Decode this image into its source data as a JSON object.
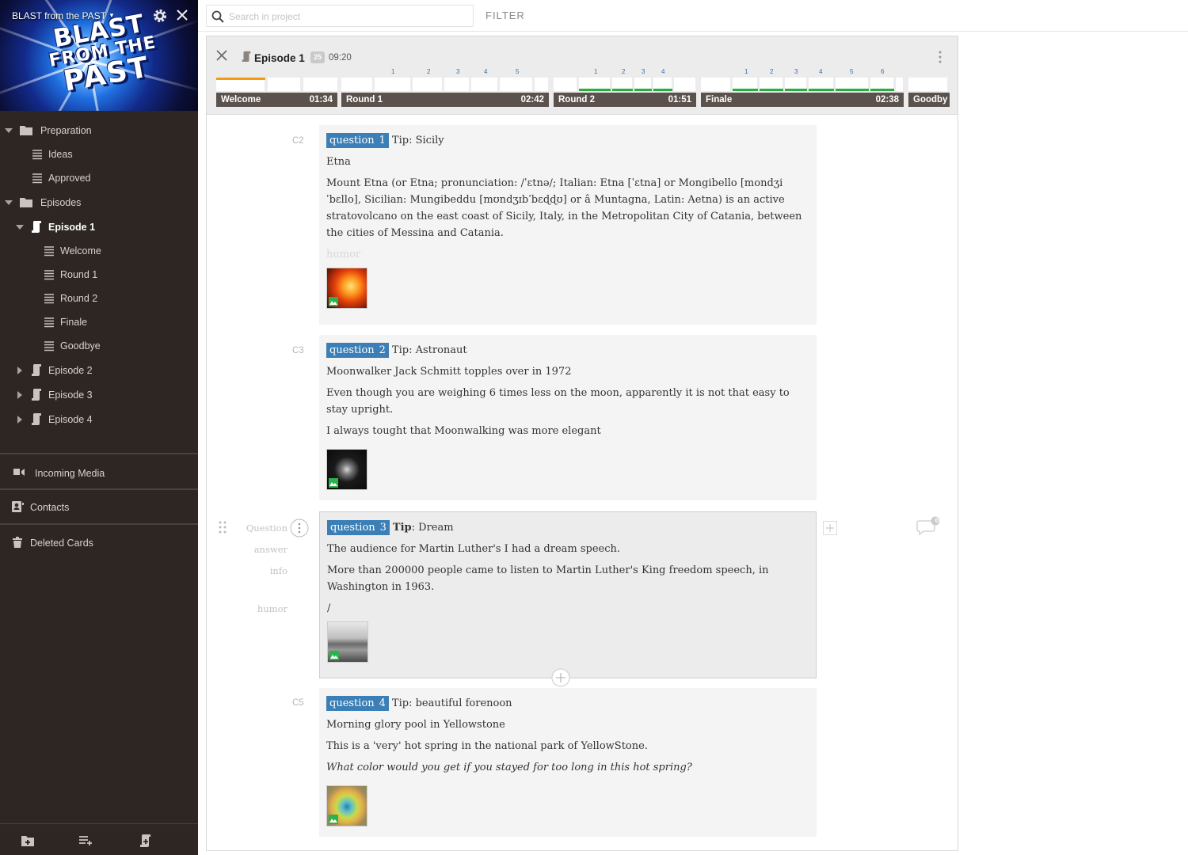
{
  "project": {
    "name": "BLAST from the PAST",
    "logo": {
      "line1": "BLAST",
      "line2": "FROM THE",
      "line3": "PAST"
    }
  },
  "tree": {
    "preparation": "Preparation",
    "ideas": "Ideas",
    "approved": "Approved",
    "episodes": "Episodes",
    "episode1": "Episode 1",
    "welcome": "Welcome",
    "round1": "Round 1",
    "round2": "Round 2",
    "finale": "Finale",
    "goodbye": "Goodbye",
    "episode2": "Episode 2",
    "episode3": "Episode 3",
    "episode4": "Episode 4"
  },
  "sidebar_items": {
    "incoming_media": "Incoming Media",
    "contacts": "Contacts",
    "deleted_cards": "Deleted Cards"
  },
  "search": {
    "placeholder": "Search in project",
    "value": ""
  },
  "filter_label": "FILTER",
  "episode": {
    "title": "Episode 1",
    "badge": "25",
    "duration": "09:20",
    "segments": [
      {
        "name": "Welcome",
        "duration": "01:34",
        "ticks": []
      },
      {
        "name": "Round 1",
        "duration": "02:42",
        "ticks": [
          "1",
          "2",
          "3",
          "4",
          "5"
        ]
      },
      {
        "name": "Round 2",
        "duration": "01:51",
        "ticks": [
          "1",
          "2",
          "3",
          "4"
        ]
      },
      {
        "name": "Finale",
        "duration": "02:38",
        "ticks": [
          "1",
          "2",
          "3",
          "4",
          "5",
          "6"
        ]
      },
      {
        "name": "Goodby",
        "duration": "",
        "ticks": []
      }
    ],
    "progress": {
      "welcome_fraction": 0.5
    }
  },
  "cards": [
    {
      "id": "C2",
      "badge": "question",
      "number": "1",
      "tip_label": "Tip",
      "tip": "Sicily",
      "answer": "Etna",
      "info": "Mount Etna (or Etna; pronunciation: /ˈɛtnə/; Italian: Etna [ˈɛtna] or Mongibello [mondʒiˈbɛllo], Sicilian: Mungibeddu [mʊndʒɪbˈbɛɖɖʊ] or â Muntagna, Latin: Aetna) is an active stratovolcano on the east coast of Sicily, Italy, in the Metropolitan City of Catania, between the cities of Messina and Catania.",
      "humor": "humor"
    },
    {
      "id": "C3",
      "badge": "question",
      "number": "2",
      "tip_label": "Tip",
      "tip": "Astronaut",
      "answer": "Moonwalker Jack Schmitt topples over in 1972",
      "info": "Even though you are weighing 6 times less on the moon, apparently it is not that easy to stay upright.",
      "humor": "I always tought that Moonwalking was more elegant"
    },
    {
      "id": "",
      "badge": "question",
      "number": "3",
      "tip_label": "Tip",
      "tip": "Dream",
      "answer": "The audience for Martin Luther's I had a dream speech.",
      "info": "More than 200000 people came to listen to Martin Luther's King freedom speech, in Washington  in 1963.",
      "humor": "/",
      "labels": {
        "question": "Question",
        "answer": "answer",
        "info": "info",
        "humor": "humor"
      },
      "comments": "0"
    },
    {
      "id": "C5",
      "badge": "question",
      "number": "4",
      "tip_label": "Tip",
      "tip": "beautiful forenoon",
      "answer": "Morning glory pool in Yellowstone",
      "info": "This is a 'very' hot spring in the national park of YellowStone.",
      "humor": "What color would you get if you stayed for too long in this hot spring?"
    }
  ],
  "colors": {
    "accent": "#3b7fb6",
    "sidebar": "#2d2622",
    "progress_orange": "#f39c12",
    "progress_green": "#27ae3f",
    "timeline_label": "#5b524d"
  },
  "icons": [
    "gear-icon",
    "close-icon",
    "search-icon",
    "folder-icon",
    "list-icon",
    "script-icon",
    "incoming-media-icon",
    "contacts-icon",
    "trash-icon",
    "more-vertical-icon",
    "image-icon",
    "drag-handle-icon",
    "plus-icon",
    "comment-icon"
  ]
}
